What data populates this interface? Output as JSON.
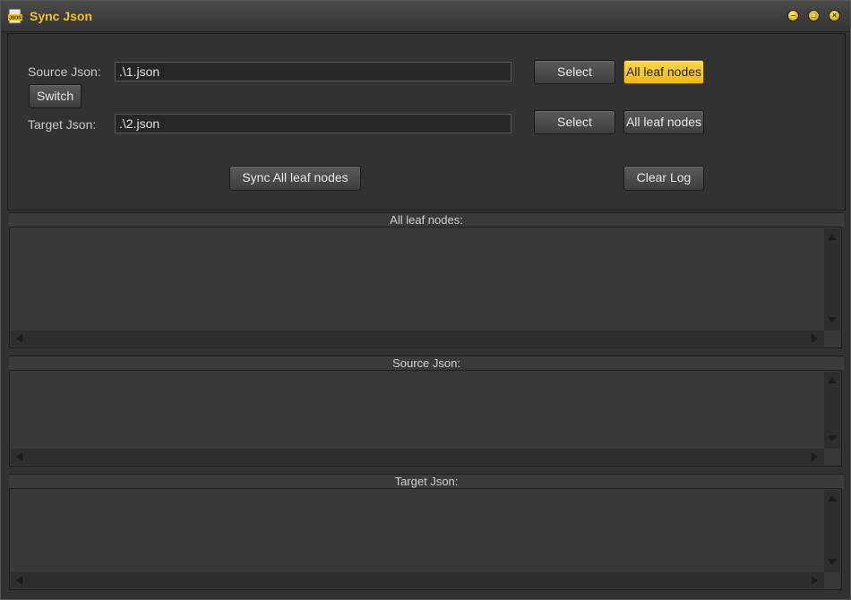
{
  "window": {
    "title": "Sync Json",
    "icon": "json-file-icon",
    "controls": [
      "minimize-icon",
      "maximize-icon",
      "close-icon"
    ]
  },
  "form": {
    "source_label": "Source Json:",
    "source_value": ".\\1.json",
    "target_label": "Target Json:",
    "target_value": ".\\2.json",
    "switch_label": "Switch",
    "select_source_label": "Select",
    "select_target_label": "Select",
    "leaf_source_label": "All leaf nodes",
    "leaf_target_label": "All leaf nodes",
    "sync_label": "Sync All leaf nodes",
    "clear_label": "Clear Log"
  },
  "sections": {
    "leaf_nodes": "All leaf nodes:",
    "source_json": "Source Json:",
    "target_json": "Target Json:"
  },
  "colors": {
    "accent": "#f0c030",
    "background": "#323232"
  }
}
